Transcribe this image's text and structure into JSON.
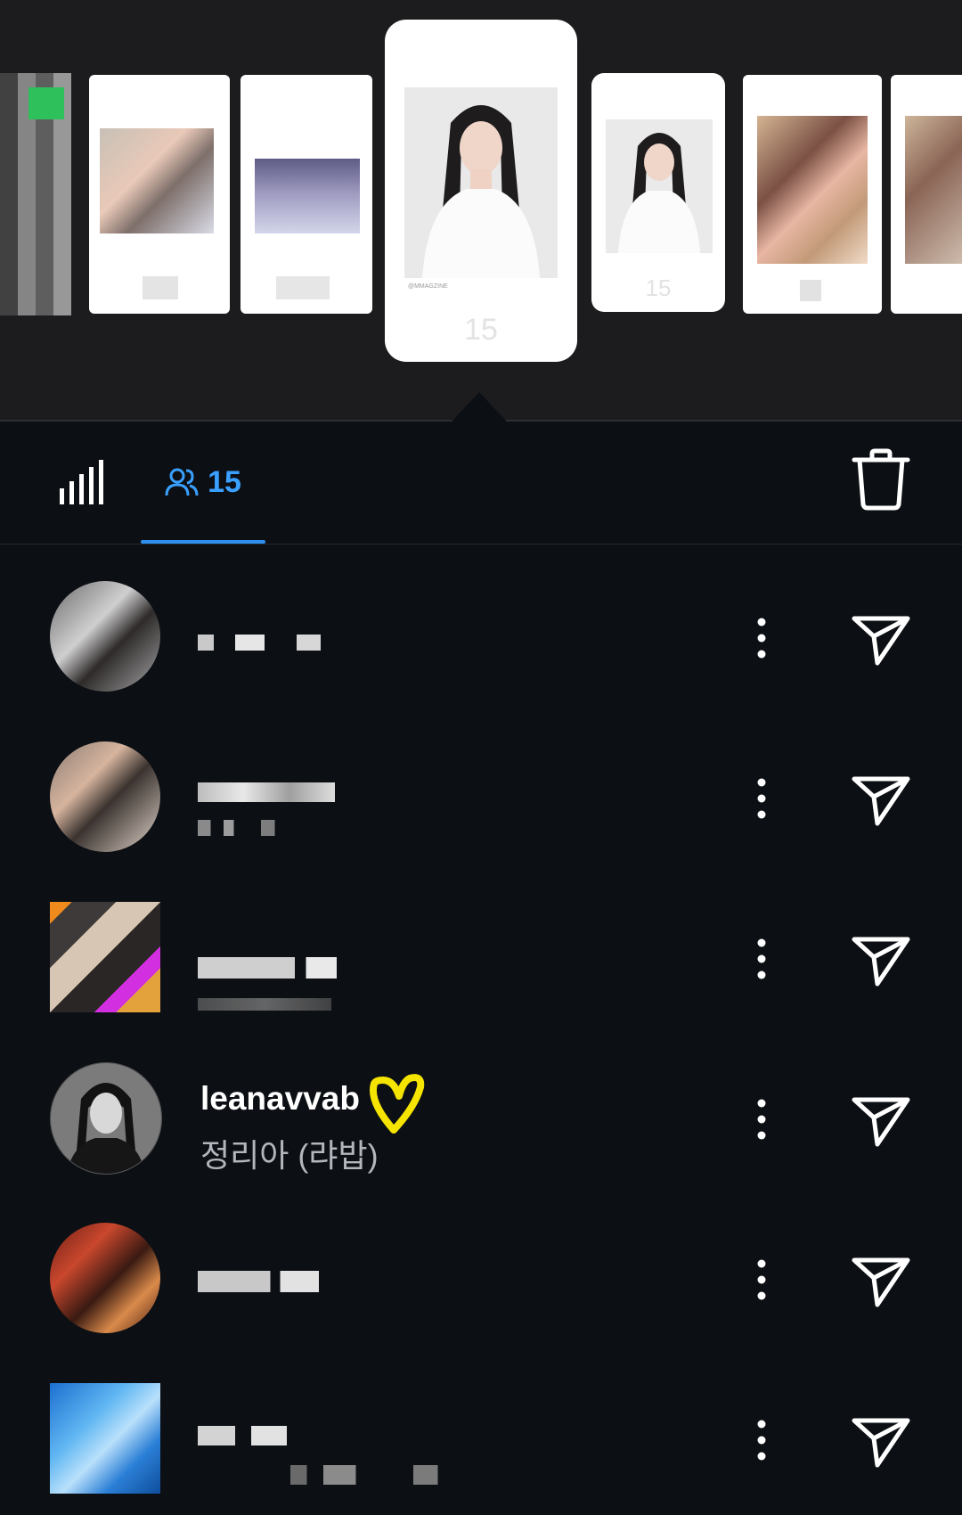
{
  "story_strip": {
    "active_view_count": "15",
    "next_view_count": "15",
    "active_credit": "@MMAGZINE"
  },
  "tabs": {
    "insights_icon": "bar-chart-icon",
    "viewers_icon": "people-icon",
    "viewers_count": "15",
    "delete_icon": "trash-icon"
  },
  "viewers": [
    {
      "username": "",
      "full_name": "",
      "censored": true
    },
    {
      "username": "",
      "full_name": "",
      "censored": true
    },
    {
      "username": "",
      "full_name": "",
      "censored": true
    },
    {
      "username": "leanavvab",
      "full_name": "정리아 (랴밥)",
      "censored": false
    },
    {
      "username": "",
      "full_name": "",
      "censored": true
    },
    {
      "username": "",
      "full_name": "",
      "censored": true
    }
  ],
  "row_icons": {
    "more": "more-vertical-icon",
    "send": "send-icon"
  },
  "colors": {
    "accent": "#2d8ef0",
    "heart": "#f5e400",
    "background": "#0c0f14"
  }
}
